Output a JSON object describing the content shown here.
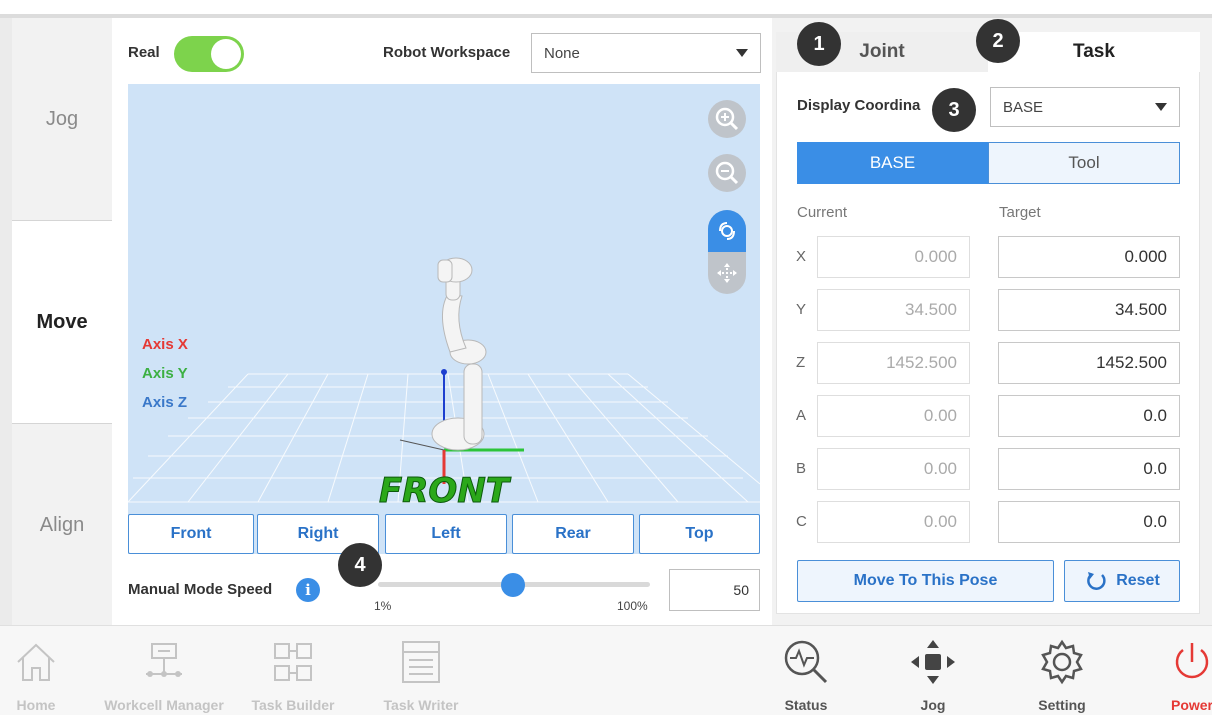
{
  "sidebar": {
    "items": [
      {
        "label": "Jog"
      },
      {
        "label": "Move"
      },
      {
        "label": "Align"
      }
    ]
  },
  "top": {
    "real_label": "Real",
    "workspace_label": "Robot Workspace",
    "workspace_value": "None"
  },
  "viewport": {
    "axis_x": "Axis X",
    "axis_y": "Axis Y",
    "axis_z": "Axis Z",
    "floor_text": "FRONT",
    "views": [
      "Front",
      "Right",
      "Left",
      "Rear",
      "Top"
    ]
  },
  "speed": {
    "label": "Manual Mode Speed",
    "min": "1%",
    "max": "100%",
    "value": "50",
    "level": 50
  },
  "right": {
    "tabs": [
      "Joint",
      "Task"
    ],
    "display_coord_label": "Display Coordina",
    "coord_value": "BASE",
    "frames": [
      "BASE",
      "Tool"
    ],
    "current_label": "Current",
    "target_label": "Target",
    "rows": [
      {
        "axis": "X",
        "current": "0.000",
        "target": "0.000"
      },
      {
        "axis": "Y",
        "current": "34.500",
        "target": "34.500"
      },
      {
        "axis": "Z",
        "current": "1452.500",
        "target": "1452.500"
      },
      {
        "axis": "A",
        "current": "0.00",
        "target": "0.0"
      },
      {
        "axis": "B",
        "current": "0.00",
        "target": "0.0"
      },
      {
        "axis": "C",
        "current": "0.00",
        "target": "0.0"
      }
    ],
    "move_button": "Move To This Pose",
    "reset_button": "Reset"
  },
  "badges": [
    "1",
    "2",
    "3",
    "4"
  ],
  "bottom": {
    "items": [
      {
        "label": "Home",
        "icon": "home-icon"
      },
      {
        "label": "Workcell Manager",
        "icon": "workcell-icon"
      },
      {
        "label": "Task Builder",
        "icon": "task-builder-icon"
      },
      {
        "label": "Task Writer",
        "icon": "task-writer-icon"
      },
      {
        "label": "Status",
        "icon": "status-icon"
      },
      {
        "label": "Jog",
        "icon": "jog-icon"
      },
      {
        "label": "Setting",
        "icon": "gear-icon"
      },
      {
        "label": "Power",
        "icon": "power-icon"
      }
    ]
  },
  "colors": {
    "accent": "#3a8ee6",
    "toggle_on": "#7dd34c",
    "power": "#e53935",
    "axis_x": "#e53935",
    "axis_y": "#3cb043",
    "axis_z": "#3a78c9"
  }
}
